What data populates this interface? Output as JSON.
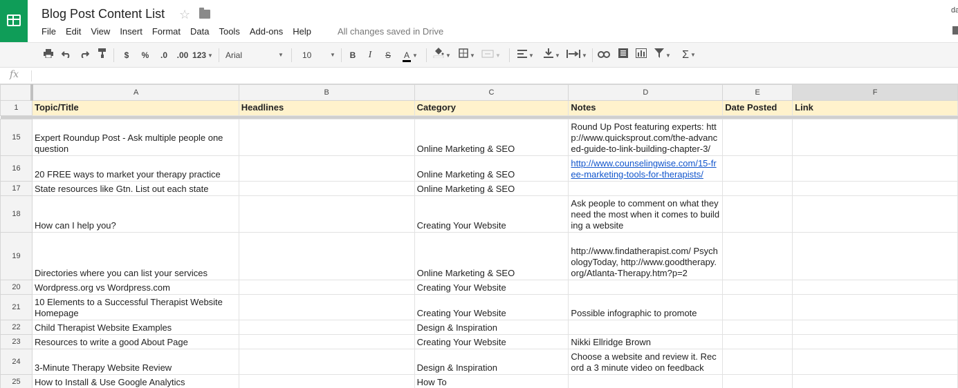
{
  "app": {
    "doc_title": "Blog Post Content List",
    "user_initials": "da",
    "save_status": "All changes saved in Drive",
    "brand_color": "#0f9d58"
  },
  "menu": [
    "File",
    "Edit",
    "View",
    "Insert",
    "Format",
    "Data",
    "Tools",
    "Add-ons",
    "Help"
  ],
  "toolbar": {
    "currency": "$",
    "percent": "%",
    "decrease_decimal": ".0",
    "increase_decimal": ".00",
    "more_formats": "123",
    "font_name": "Arial",
    "font_size": "10",
    "bold": "B",
    "italic": "I",
    "strikethrough": "S",
    "text_color": "A",
    "functions": "Σ"
  },
  "formula_bar": {
    "label": "fx"
  },
  "columns": [
    "A",
    "B",
    "C",
    "D",
    "E",
    "F"
  ],
  "header_row": {
    "row_number": "1",
    "cells": [
      "Topic/Title",
      "Headlines",
      "Category",
      "Notes",
      "Date Posted",
      "Link"
    ]
  },
  "rows": [
    {
      "num": "15",
      "a": "Expert Roundup Post - Ask multiple people one question",
      "b": "",
      "c": "Online Marketing & SEO",
      "d": "Round Up Post featuring experts: http://www.quicksprout.com/the-advanced-guide-to-link-building-chapter-3/",
      "e": "",
      "f": ""
    },
    {
      "num": "16",
      "a": "20 FREE ways to market your therapy practice",
      "b": "",
      "c": "Online Marketing & SEO",
      "d": "http://www.counselingwise.com/15-free-marketing-tools-for-therapists/",
      "e": "",
      "f": ""
    },
    {
      "num": "17",
      "a": "State resources like Gtn. List out each state",
      "b": "",
      "c": "Online Marketing & SEO",
      "d": "",
      "e": "",
      "f": ""
    },
    {
      "num": "18",
      "a": "How can I help you?",
      "b": "",
      "c": "Creating Your Website",
      "d": "Ask people to comment on what they need the most when it comes to building a website",
      "e": "",
      "f": ""
    },
    {
      "num": "19",
      "a": "Directories where you can list your services",
      "b": "",
      "c": "Online Marketing & SEO",
      "d": "http://www.findatherapist.com/ PsychologyToday, http://www.goodtherapy.org/Atlanta-Therapy.htm?p=2",
      "e": "",
      "f": ""
    },
    {
      "num": "20",
      "a": "Wordpress.org vs Wordpress.com",
      "b": "",
      "c": "Creating Your Website",
      "d": "",
      "e": "",
      "f": ""
    },
    {
      "num": "21",
      "a": "10 Elements to a Successful Therapist Website Homepage",
      "b": "",
      "c": "Creating Your Website",
      "d": "Possible infographic to promote",
      "e": "",
      "f": ""
    },
    {
      "num": "22",
      "a": "Child Therapist Website Examples",
      "b": "",
      "c": "Design & Inspiration",
      "d": "",
      "e": "",
      "f": ""
    },
    {
      "num": "23",
      "a": "Resources to write a good About Page",
      "b": "",
      "c": "Creating Your Website",
      "d": "Nikki Ellridge Brown",
      "e": "",
      "f": ""
    },
    {
      "num": "24",
      "a": "3-Minute Therapy Website Review",
      "b": "",
      "c": "Design & Inspiration",
      "d": "Choose a website and review it. Record a 3 minute video on feedback",
      "e": "",
      "f": ""
    },
    {
      "num": "25",
      "a": "How to Install & Use Google Analytics",
      "b": "",
      "c": "How To",
      "d": "",
      "e": "",
      "f": ""
    }
  ]
}
